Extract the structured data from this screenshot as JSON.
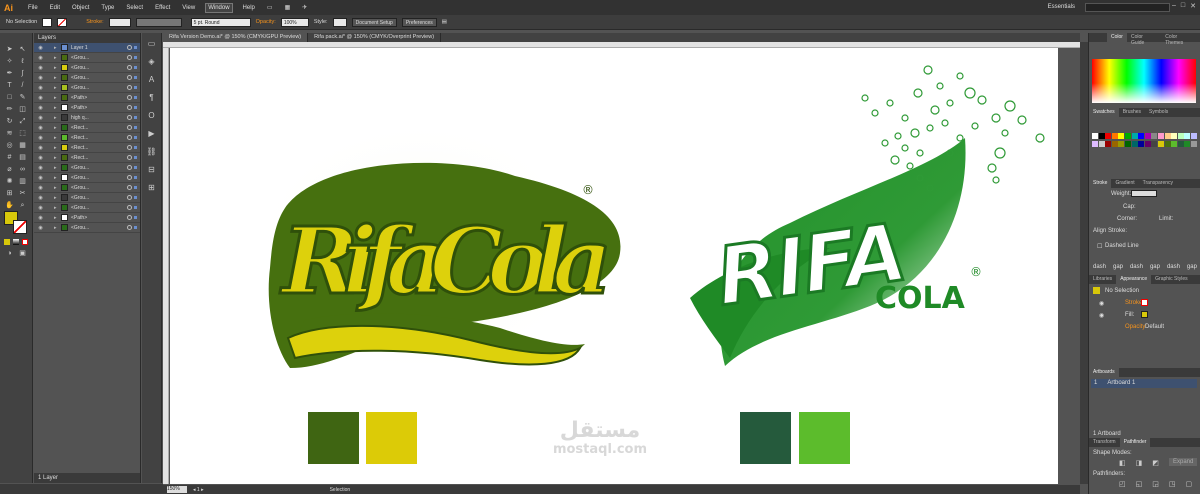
{
  "app": {
    "logo": "Ai",
    "workspace": "Essentials"
  },
  "menu": [
    "File",
    "Edit",
    "Object",
    "Type",
    "Select",
    "Effect",
    "View",
    "Window",
    "Help"
  ],
  "control": {
    "selection": "No Selection",
    "stroke_label": "Stroke:",
    "brush": "5 pt. Round",
    "opacity_label": "Opacity:",
    "opacity": "100%",
    "style_label": "Style:",
    "doc_setup": "Document Setup",
    "preferences": "Preferences"
  },
  "tabs": [
    "Rifa Version Demo.ai* @ 150% (CMYK/GPU Preview)",
    "Rifa pack.ai* @ 150% (CMYK/Overprint Preview)"
  ],
  "layers": {
    "title": "Layers",
    "rows": [
      {
        "name": "Layer 1",
        "color": "#6b8fcf",
        "sel": true
      },
      {
        "name": "<Grou...",
        "color": "#4a6b12"
      },
      {
        "name": "<Grou...",
        "color": "#d8cc10"
      },
      {
        "name": "<Grou...",
        "color": "#4a6b12"
      },
      {
        "name": "<Grou...",
        "color": "#a8c020"
      },
      {
        "name": "<Path>",
        "color": "#4a6b12"
      },
      {
        "name": "<Path>",
        "color": "#ffffff"
      },
      {
        "name": "high q...",
        "color": "#3a3a3a"
      },
      {
        "name": "<Rect...",
        "color": "#2a6b1a"
      },
      {
        "name": "<Rect...",
        "color": "#5cb82c"
      },
      {
        "name": "<Rect...",
        "color": "#d8cc10"
      },
      {
        "name": "<Rect...",
        "color": "#4a6b12"
      },
      {
        "name": "<Grou...",
        "color": "#2a6b1a"
      },
      {
        "name": "<Grou...",
        "color": "#ffffff"
      },
      {
        "name": "<Grou...",
        "color": "#2a6b1a"
      },
      {
        "name": "<Grou...",
        "color": "#3a3a3a"
      },
      {
        "name": "<Grou...",
        "color": "#2a6b1a"
      },
      {
        "name": "<Path>",
        "color": "#ffffff"
      },
      {
        "name": "<Grou...",
        "color": "#2a6b1a"
      }
    ],
    "footer": "1 Layer"
  },
  "status": {
    "zoom": "150%",
    "tool": "Selection"
  },
  "right": {
    "color_tabs": [
      "Color",
      "Color Guide",
      "Color Themes"
    ],
    "swatch_tabs": [
      "Swatches",
      "Brushes",
      "Symbols"
    ],
    "stroke_tabs": [
      "Stroke",
      "Gradient",
      "Transparency"
    ],
    "weight": "Weight:",
    "cap": "Cap:",
    "corner": "Corner:",
    "limit": "Limit:",
    "align": "Align Stroke:",
    "dashed": "Dashed Line",
    "dash_labels": [
      "dash",
      "gap",
      "dash",
      "gap",
      "dash",
      "gap"
    ],
    "app_tabs": [
      "Libraries",
      "Appearance",
      "Graphic Styles"
    ],
    "no_selection": "No Selection",
    "stroke": "Stroke:",
    "fill": "Fill:",
    "opacity": "Opacity:",
    "default": "Default",
    "artboards_title": "Artboards",
    "artboard_num": "1",
    "artboard_name": "Artboard 1",
    "artboard_count": "1 Artboard",
    "pf_tabs": [
      "Transform",
      "Pathfinder"
    ],
    "shape_modes": "Shape Modes:",
    "pathfinders": "Pathfinders:",
    "expand": "Expand"
  },
  "art": {
    "logo1_text": "RifaCola",
    "logo2_word1": "RIFA",
    "logo2_word2": "COLA",
    "registered": "®",
    "palette_left": [
      "#3f6512",
      "#dccb07"
    ],
    "palette_right": [
      "#255a3c",
      "#5cbc2c"
    ]
  },
  "watermark": {
    "arabic": "مستقل",
    "latin": "mostaql.com"
  }
}
